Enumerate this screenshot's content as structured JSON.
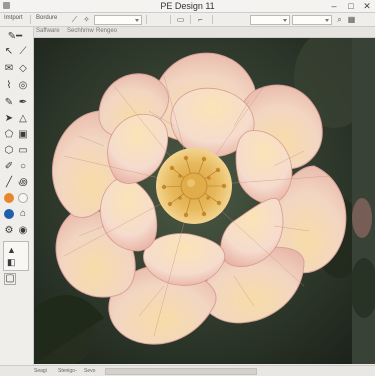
{
  "window": {
    "title": "PE Design 11",
    "minimize_glyph": "–",
    "maximize_glyph": "□",
    "close_glyph": "✕"
  },
  "toolbar": {
    "import_label": "Imtport",
    "bordure_label": "Bordure",
    "font_select_value": ""
  },
  "tabs": [
    {
      "label": "Saffware"
    },
    {
      "label": "Sechhrnw"
    },
    {
      "label": "Rengeo"
    }
  ],
  "tools": [
    {
      "icon": "pencil-icon"
    },
    {
      "icon": "select-arrow-icon"
    },
    {
      "icon": "envelope-icon"
    },
    {
      "icon": "brush-icon"
    },
    {
      "icon": "triangle-icon"
    },
    {
      "icon": "pentagon-icon"
    },
    {
      "icon": "circle-icon"
    },
    {
      "icon": "stamp-icon"
    },
    {
      "icon": "spiral-icon"
    },
    {
      "icon": "swatch-orange"
    },
    {
      "icon": "swatch-blue"
    },
    {
      "icon": "gear-icon"
    },
    {
      "icon": "layers-icon"
    }
  ],
  "colors": {
    "swatch_orange": "#e8862b",
    "swatch_blue": "#1f5fae"
  },
  "statusbar": {
    "item1": "Seagi",
    "item2": "Stenigo-",
    "item3": "Sevo"
  }
}
